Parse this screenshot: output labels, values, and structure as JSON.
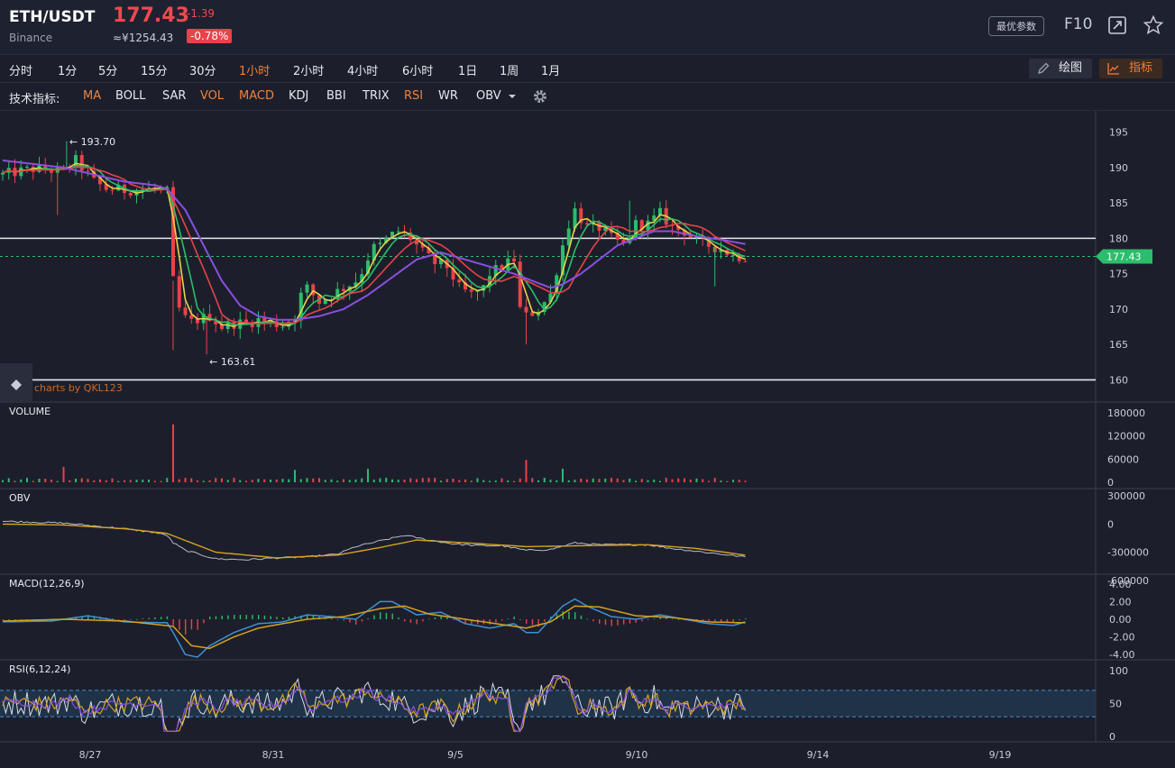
{
  "header": {
    "symbol": "ETH/USDT",
    "exchange": "Binance",
    "price": "177.43",
    "change": "-1.39",
    "cny_price": "≈¥1254.43",
    "change_pct": "-0.78%",
    "params_button": "最优参数",
    "f10": "F10",
    "icons": [
      "fullscreen-icon",
      "star-icon"
    ]
  },
  "timeframes": [
    {
      "label": "分时",
      "active": false
    },
    {
      "label": "1分",
      "active": false
    },
    {
      "label": "5分",
      "active": false
    },
    {
      "label": "15分",
      "active": false
    },
    {
      "label": "30分",
      "active": false
    },
    {
      "label": "1小时",
      "active": true
    },
    {
      "label": "2小时",
      "active": false
    },
    {
      "label": "4小时",
      "active": false
    },
    {
      "label": "6小时",
      "active": false
    },
    {
      "label": "1日",
      "active": false
    },
    {
      "label": "1周",
      "active": false
    },
    {
      "label": "1月",
      "active": false
    }
  ],
  "tools": {
    "draw": "绘图",
    "indicators": "指标"
  },
  "indicator_bar": {
    "label": "技术指标:",
    "items": [
      {
        "label": "MA",
        "active": true
      },
      {
        "label": "BOLL",
        "active": false
      },
      {
        "label": "SAR",
        "active": false
      },
      {
        "label": "VOL",
        "active": true
      },
      {
        "label": "MACD",
        "active": true
      },
      {
        "label": "KDJ",
        "active": false
      },
      {
        "label": "BBI",
        "active": false
      },
      {
        "label": "TRIX",
        "active": false
      },
      {
        "label": "RSI",
        "active": true
      },
      {
        "label": "WR",
        "active": false
      },
      {
        "label": "OBV",
        "active": false
      }
    ],
    "settings_icon": "gear-icon"
  },
  "colors": {
    "up": "#2bbd6b",
    "down": "#e8424a",
    "accent": "#f0813a",
    "ma_fast": "#e8d247",
    "ma_mid": "#2bbd6b",
    "ma_slow": "#e8424a",
    "ma_long": "#8a4fe0"
  },
  "chart_data": {
    "type": "candlestick",
    "watermark": "charts by QKL123",
    "x_ticks": [
      "8/27",
      "8/31",
      "9/5",
      "9/10",
      "9/14",
      "9/19"
    ],
    "price_panel": {
      "ylim": [
        157,
        198
      ],
      "y_ticks": [
        195,
        190,
        185,
        180,
        175,
        170,
        165,
        160
      ],
      "last_price": "177.43",
      "high_marker": "193.70",
      "low_marker": "163.61",
      "horizontal_lines": [
        180,
        160
      ],
      "close_path": [
        [
          0,
          189
        ],
        [
          5,
          189.8
        ],
        [
          10,
          189.5
        ],
        [
          12,
          191
        ],
        [
          15,
          188
        ],
        [
          17,
          187
        ],
        [
          20,
          186.8
        ],
        [
          25,
          187
        ],
        [
          27,
          186.5
        ],
        [
          27.6,
          178
        ],
        [
          28.2,
          172
        ],
        [
          29,
          170
        ],
        [
          30.5,
          168
        ],
        [
          32,
          168.5
        ],
        [
          34,
          169
        ],
        [
          36,
          167.5
        ],
        [
          38,
          168
        ],
        [
          40,
          168
        ],
        [
          42,
          168.5
        ],
        [
          44,
          168
        ],
        [
          46,
          167.8
        ],
        [
          48,
          169
        ],
        [
          49,
          172
        ],
        [
          50,
          173
        ],
        [
          52,
          171
        ],
        [
          54,
          172
        ],
        [
          56,
          173
        ],
        [
          58,
          174
        ],
        [
          59.5,
          176
        ],
        [
          60.5,
          178.5
        ],
        [
          62,
          179
        ],
        [
          64,
          180.5
        ],
        [
          65,
          181
        ],
        [
          67,
          180
        ],
        [
          69,
          178
        ],
        [
          71,
          176.5
        ],
        [
          73,
          176
        ],
        [
          75,
          173
        ],
        [
          77,
          172
        ],
        [
          79,
          173
        ],
        [
          80,
          175
        ],
        [
          82,
          176
        ],
        [
          84,
          177
        ],
        [
          85,
          170
        ],
        [
          86,
          169
        ],
        [
          88,
          170
        ],
        [
          89,
          171
        ],
        [
          90,
          172
        ],
        [
          92,
          179
        ],
        [
          93,
          182
        ],
        [
          94,
          184
        ],
        [
          96,
          181.5
        ],
        [
          98,
          181.5
        ],
        [
          100,
          180
        ],
        [
          102,
          179
        ],
        [
          104,
          182
        ],
        [
          106,
          182
        ],
        [
          108,
          183.5
        ],
        [
          110,
          181.5
        ],
        [
          112,
          181
        ],
        [
          114,
          179.5
        ],
        [
          116,
          179
        ],
        [
          118,
          178.5
        ],
        [
          120,
          177.5
        ],
        [
          122,
          177.4
        ]
      ],
      "ma_long_path": [
        [
          0,
          191
        ],
        [
          5,
          190.5
        ],
        [
          10,
          190
        ],
        [
          15,
          189
        ],
        [
          20,
          188
        ],
        [
          25,
          187.5
        ],
        [
          27,
          187
        ],
        [
          30,
          184
        ],
        [
          33,
          179
        ],
        [
          36,
          174
        ],
        [
          39,
          170.5
        ],
        [
          42,
          169
        ],
        [
          45,
          168.5
        ],
        [
          48,
          168.5
        ],
        [
          52,
          169
        ],
        [
          56,
          170
        ],
        [
          60,
          172
        ],
        [
          64,
          174.5
        ],
        [
          68,
          177
        ],
        [
          72,
          178
        ],
        [
          76,
          177
        ],
        [
          80,
          176
        ],
        [
          84,
          175
        ],
        [
          87,
          174
        ],
        [
          90,
          173
        ],
        [
          92,
          173.5
        ],
        [
          95,
          175
        ],
        [
          98,
          177
        ],
        [
          101,
          179
        ],
        [
          104,
          180
        ],
        [
          107,
          181
        ],
        [
          110,
          181
        ],
        [
          114,
          180.3
        ],
        [
          118,
          179.8
        ],
        [
          122,
          179.2
        ]
      ]
    },
    "volume_panel": {
      "title": "VOLUME",
      "y_ticks": [
        "180000",
        "120000",
        "60000",
        "0"
      ],
      "spikes": [
        [
          28,
          150000
        ],
        [
          86,
          58000
        ],
        [
          92,
          35000
        ],
        [
          10,
          40000
        ],
        [
          60,
          35000
        ],
        [
          48,
          32000
        ]
      ]
    },
    "obv_panel": {
      "title": "OBV",
      "y_ticks": [
        "300000",
        "0",
        "-300000",
        "-600000"
      ],
      "obv_path": [
        [
          0,
          30000
        ],
        [
          5,
          20000
        ],
        [
          10,
          10000
        ],
        [
          15,
          -20000
        ],
        [
          20,
          -50000
        ],
        [
          25,
          -90000
        ],
        [
          27,
          -120000
        ],
        [
          28,
          -200000
        ],
        [
          30,
          -280000
        ],
        [
          35,
          -370000
        ],
        [
          40,
          -380000
        ],
        [
          45,
          -360000
        ],
        [
          50,
          -350000
        ],
        [
          55,
          -320000
        ],
        [
          58,
          -240000
        ],
        [
          62,
          -180000
        ],
        [
          66,
          -120000
        ],
        [
          70,
          -170000
        ],
        [
          74,
          -210000
        ],
        [
          78,
          -230000
        ],
        [
          82,
          -230000
        ],
        [
          86,
          -280000
        ],
        [
          90,
          -270000
        ],
        [
          94,
          -200000
        ],
        [
          98,
          -220000
        ],
        [
          102,
          -220000
        ],
        [
          106,
          -220000
        ],
        [
          110,
          -260000
        ],
        [
          114,
          -290000
        ],
        [
          118,
          -320000
        ],
        [
          122,
          -350000
        ]
      ],
      "signal_path": [
        [
          0,
          0
        ],
        [
          10,
          -10000
        ],
        [
          20,
          -50000
        ],
        [
          27,
          -100000
        ],
        [
          35,
          -300000
        ],
        [
          45,
          -360000
        ],
        [
          55,
          -330000
        ],
        [
          62,
          -250000
        ],
        [
          68,
          -170000
        ],
        [
          76,
          -200000
        ],
        [
          86,
          -240000
        ],
        [
          96,
          -230000
        ],
        [
          106,
          -220000
        ],
        [
          114,
          -260000
        ],
        [
          122,
          -330000
        ]
      ]
    },
    "macd_panel": {
      "title": "MACD(12,26,9)",
      "y_ticks": [
        "4.00",
        "2.00",
        "0.00",
        "-2.00",
        "-4.00"
      ],
      "dif_path": [
        [
          0,
          -0.3
        ],
        [
          8,
          -0.2
        ],
        [
          14,
          0.4
        ],
        [
          20,
          -0.3
        ],
        [
          27,
          -0.4
        ],
        [
          28,
          -1.5
        ],
        [
          30,
          -4
        ],
        [
          32,
          -4.3
        ],
        [
          34,
          -3
        ],
        [
          38,
          -1.5
        ],
        [
          42,
          -0.5
        ],
        [
          46,
          -0.3
        ],
        [
          50,
          0.5
        ],
        [
          54,
          0.3
        ],
        [
          58,
          0
        ],
        [
          62,
          2
        ],
        [
          64,
          2
        ],
        [
          68,
          0.5
        ],
        [
          72,
          0.8
        ],
        [
          76,
          -0.5
        ],
        [
          80,
          -1
        ],
        [
          84,
          -0.5
        ],
        [
          86,
          -1.5
        ],
        [
          88,
          -1.5
        ],
        [
          92,
          1.5
        ],
        [
          94,
          2.3
        ],
        [
          96,
          1.5
        ],
        [
          100,
          0.3
        ],
        [
          104,
          0
        ],
        [
          108,
          0.5
        ],
        [
          112,
          0
        ],
        [
          116,
          -0.5
        ],
        [
          120,
          -0.7
        ],
        [
          122,
          -0.3
        ]
      ],
      "dea_path": [
        [
          0,
          -0.2
        ],
        [
          10,
          0
        ],
        [
          20,
          -0.2
        ],
        [
          28,
          -0.8
        ],
        [
          31,
          -3
        ],
        [
          34,
          -3.3
        ],
        [
          38,
          -2
        ],
        [
          42,
          -1
        ],
        [
          50,
          0
        ],
        [
          56,
          0.3
        ],
        [
          62,
          1.2
        ],
        [
          66,
          1.5
        ],
        [
          70,
          0.6
        ],
        [
          76,
          0
        ],
        [
          82,
          -0.6
        ],
        [
          86,
          -1
        ],
        [
          90,
          -0.3
        ],
        [
          94,
          1.5
        ],
        [
          98,
          1.4
        ],
        [
          104,
          0.4
        ],
        [
          110,
          0.2
        ],
        [
          116,
          -0.3
        ],
        [
          122,
          -0.4
        ]
      ]
    },
    "rsi_panel": {
      "title": "RSI(6,12,24)",
      "y_ticks": [
        "100",
        "50",
        "0"
      ],
      "band": [
        30,
        70
      ]
    }
  }
}
